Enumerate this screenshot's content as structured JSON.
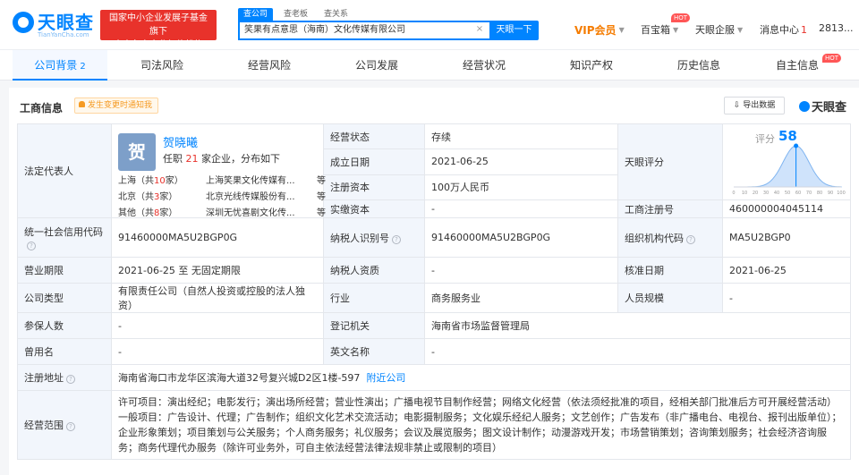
{
  "brand": {
    "logo_text": "天眼查",
    "logo_sub": "TianYanCha.com",
    "banner_line1": "国家中小企业发展子基金旗下",
    "banner_line2": "官方备案企业征信机构"
  },
  "search": {
    "tabs": [
      "查公司",
      "查老板",
      "查关系"
    ],
    "value": "笑果有点意思（海南）文化传媒有限公司",
    "button": "天眼一下"
  },
  "nav": {
    "vip": "VIP会员",
    "baibaoxiang": "百宝箱",
    "qiyeban": "天眼企服",
    "messages": "消息中心",
    "message_count": "1",
    "user": "2813...",
    "hot": "HOT"
  },
  "tabs": [
    {
      "label": "公司背景",
      "count": "2"
    },
    {
      "label": "司法风险"
    },
    {
      "label": "经营风险"
    },
    {
      "label": "公司发展"
    },
    {
      "label": "经营状况"
    },
    {
      "label": "知识产权"
    },
    {
      "label": "历史信息"
    },
    {
      "label": "自主信息"
    }
  ],
  "tab_hot": "HOT",
  "section": {
    "title": "工商信息",
    "notify": "发生变更时通知我",
    "export": "导出数据",
    "watermark": "天眼查"
  },
  "legal_rep": {
    "label": "法定代表人",
    "avatar_char": "贺",
    "name": "贺晓曦",
    "desc_prefix": "任职",
    "desc_num": "21",
    "desc_suffix": "家企业，分布如下",
    "rows": [
      {
        "city": "上海",
        "pre": "（共",
        "n": "10",
        "post": "家）",
        "company": "上海笑果文化传媒有...",
        "etc": "等"
      },
      {
        "city": "北京",
        "pre": "（共",
        "n": "3",
        "post": "家）",
        "company": "北京光线传媒股份有...",
        "etc": "等"
      },
      {
        "city": "其他",
        "pre": "（共",
        "n": "8",
        "post": "家）",
        "company": "深圳无忧喜剧文化传...",
        "etc": "等"
      }
    ]
  },
  "fields": {
    "status_k": "经营状态",
    "status_v": "存续",
    "founded_k": "成立日期",
    "founded_v": "2021-06-25",
    "capital_k": "注册资本",
    "capital_v": "100万人民币",
    "paid_k": "实缴资本",
    "paid_v": "-",
    "score_k": "天眼评分",
    "score_label": "评分",
    "score_value": "58",
    "regno_k": "工商注册号",
    "regno_v": "460000004045114",
    "credit_k": "统一社会信用代码",
    "credit_v": "91460000MA5U2BGP0G",
    "taxid_k": "纳税人识别号",
    "taxid_v": "91460000MA5U2BGP0G",
    "orgcode_k": "组织机构代码",
    "orgcode_v": "MA5U2BGP0",
    "term_k": "营业期限",
    "term_v": "2021-06-25  至 无固定期限",
    "taxq_k": "纳税人资质",
    "taxq_v": "-",
    "approve_k": "核准日期",
    "approve_v": "2021-06-25",
    "type_k": "公司类型",
    "type_v": "有限责任公司（自然人投资或控股的法人独资）",
    "industry_k": "行业",
    "industry_v": "商务服务业",
    "staff_k": "人员规模",
    "staff_v": "-",
    "insured_k": "参保人数",
    "insured_v": "-",
    "authority_k": "登记机关",
    "authority_v": "海南省市场监督管理局",
    "formername_k": "曾用名",
    "formername_v": "-",
    "ename_k": "英文名称",
    "ename_v": "-",
    "address_k": "注册地址",
    "address_v": "海南省海口市龙华区滨海大道32号复兴城D2区1楼-597",
    "address_link": "附近公司",
    "scope_k": "经营范围",
    "scope_v": "许可项目：演出经纪；电影发行；演出场所经营；营业性演出；广播电视节目制作经营；网络文化经营（依法须经批准的项目，经相关部门批准后方可开展经营活动）一般项目：广告设计、代理；广告制作；组织文化艺术交流活动；电影摄制服务；文化娱乐经纪人服务；文艺创作；广告发布（非广播电台、电视台、报刊出版单位）；企业形象策划；项目策划与公关服务；个人商务服务；礼仪服务；会议及展览服务；图文设计制作；动漫游戏开发；市场营销策划；咨询策划服务；社会经济咨询服务；商务代理代办服务（除许可业务外，可自主依法经营法律法规非禁止或限制的项目）"
  },
  "score_chart": {
    "type": "area",
    "x_ticks": [
      "0",
      "10",
      "20",
      "30",
      "40",
      "50",
      "60",
      "70",
      "80",
      "90",
      "100"
    ],
    "marker": 58,
    "colors": {
      "fill": "#cfe3fb",
      "line": "#7fb4f0",
      "marker": "#0084ff"
    }
  },
  "colors": {
    "accent": "#0084ff",
    "red": "#e8322b",
    "vip": "#f57c00"
  }
}
